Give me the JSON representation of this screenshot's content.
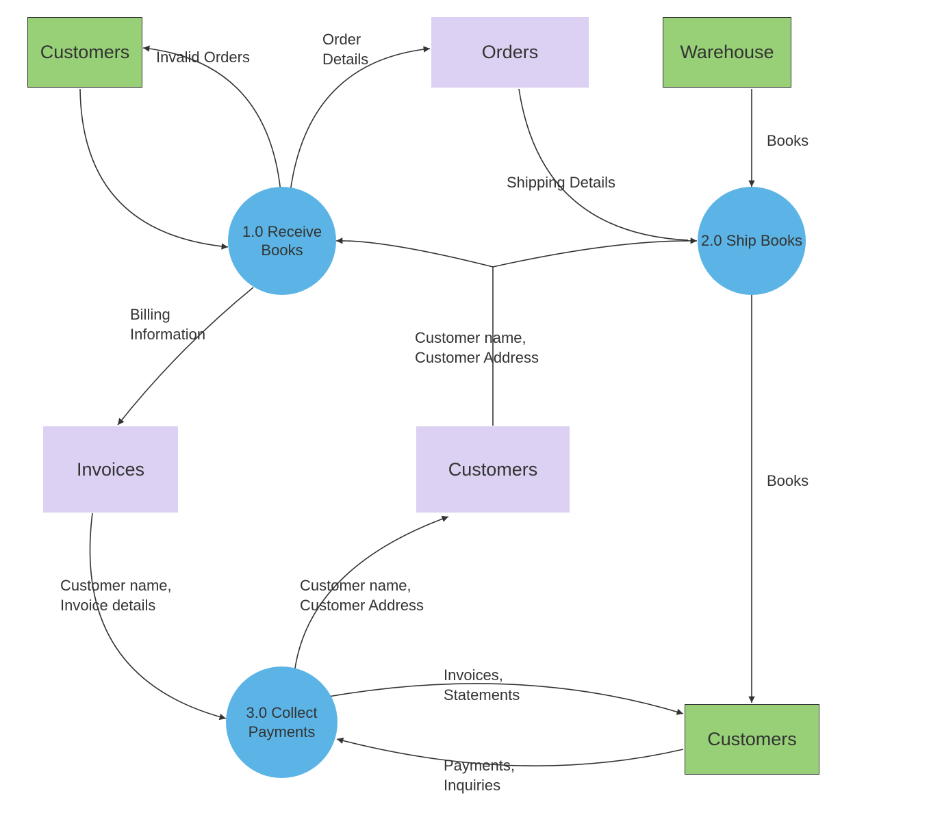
{
  "entities": {
    "customers_tl": "Customers",
    "warehouse": "Warehouse",
    "customers_br": "Customers"
  },
  "datastores": {
    "orders": "Orders",
    "invoices": "Invoices",
    "customers_mid": "Customers"
  },
  "processes": {
    "p1": "1.0\nReceive\nBooks",
    "p2": "2.0\nShip\nBooks",
    "p3": "3.0\nCollect\nPayments"
  },
  "labels": {
    "invalid_orders": "Invalid Orders",
    "order_details": "Order\nDetails",
    "books_top": "Books",
    "shipping_details": "Shipping Details",
    "billing_info": "Billing\nInformation",
    "cust_name_addr_top": "Customer name,\nCustomer Address",
    "books_mid": "Books",
    "cust_name_invoice": "Customer name,\nInvoice details",
    "cust_name_addr_bot": "Customer name,\nCustomer Address",
    "invoices_stmts": "Invoices,\nStatements",
    "payments_inq": "Payments,\nInquiries"
  }
}
